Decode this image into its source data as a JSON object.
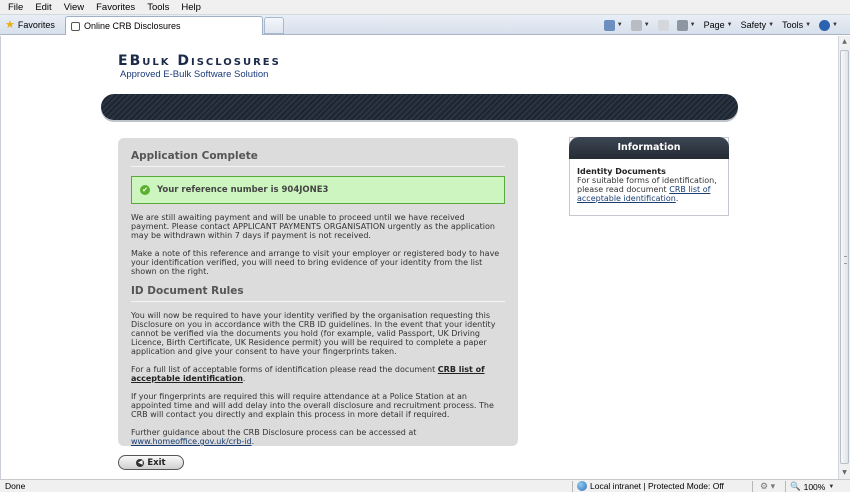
{
  "menu": [
    "File",
    "Edit",
    "View",
    "Favorites",
    "Tools",
    "Help"
  ],
  "favorites_label": "Favorites",
  "tab_title": "Online CRB Disclosures",
  "commands": {
    "page": "Page",
    "safety": "Safety",
    "tools": "Tools"
  },
  "logo": {
    "title": "EBulk Disclosures",
    "subtitle": "Approved E-Bulk Software Solution"
  },
  "main": {
    "heading1": "Application Complete",
    "reference_text": "Your reference number is 904JONE3",
    "para1": "We are still awaiting payment and will be unable to proceed until we have received payment. Please contact APPLICANT PAYMENTS ORGANISATION urgently as the application may be withdrawn within 7 days if payment is not received.",
    "para2": "Make a note of this reference and arrange to visit your employer or registered body to have your identification verified, you will need to bring evidence of your identity from the list shown on the right.",
    "heading2": "ID Document Rules",
    "para3": "You will now be required to have your identity verified by the organisation requesting this Disclosure on you in accordance with the CRB ID guidelines. In the event that your identity cannot be verified via the documents you hold (for example, valid Passport, UK Driving Licence, Birth Certificate, UK Residence permit) you will be required to complete a paper application and give your consent to have your fingerprints taken.",
    "para4_prefix": "For a full list of acceptable forms of identification please read the document ",
    "para4_link": "CRB list of acceptable identification",
    "para4_suffix": ".",
    "para5": "If your fingerprints are required this will require attendance at a Police Station at an appointed time and will add delay into the overall disclosure and recruitment process. The CRB will contact you directly and explain this process in more detail if required.",
    "para6_prefix": "Further guidance about the CRB Disclosure process can be accessed at",
    "para6_link": "www.homeoffice.gov.uk/crb-id",
    "para6_suffix": "."
  },
  "exit_label": "Exit",
  "info": {
    "header": "Information",
    "title": "Identity Documents",
    "text_prefix": "For suitable forms of identification, please read document ",
    "link": "CRB list of acceptable identification",
    "text_suffix": "."
  },
  "status": {
    "left": "Done",
    "zone": "Local intranet | Protected Mode: Off",
    "zoom": "100%"
  },
  "colors": {
    "banner": "#2a3442",
    "success_bg": "#ccf5bf",
    "success_border": "#58a83a",
    "link": "#1a3e73",
    "panel": "#dcdcdc"
  }
}
